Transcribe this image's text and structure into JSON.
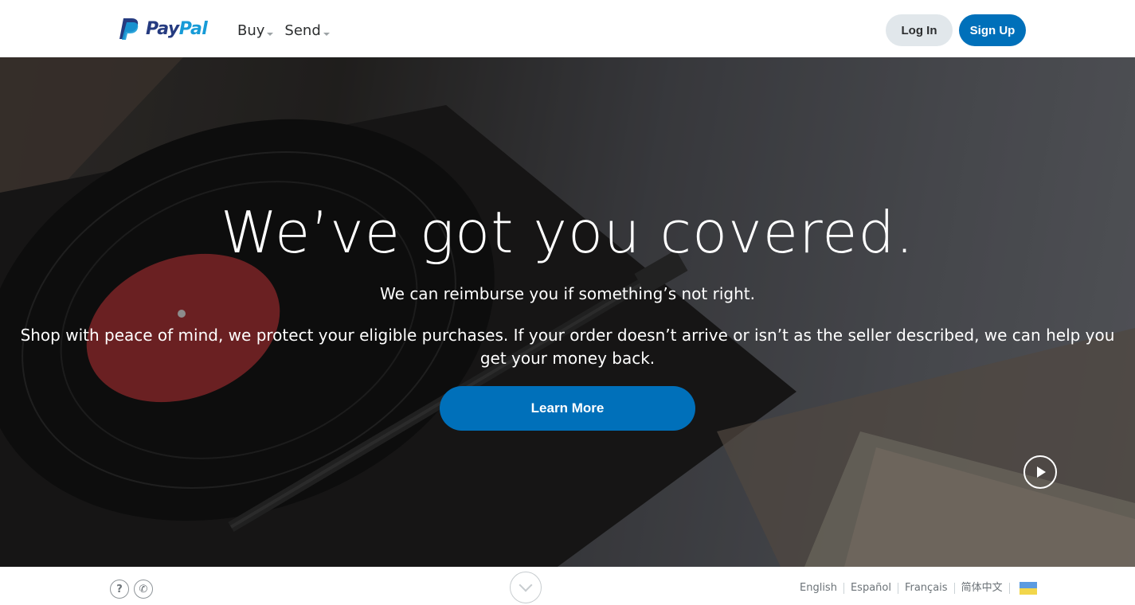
{
  "brand": {
    "name_part1": "Pay",
    "name_part2": "Pal",
    "primary_color": "#253b80",
    "secondary_color": "#179bd7",
    "accent_color": "#0070ba"
  },
  "nav": {
    "items": [
      {
        "label": "Buy",
        "icon": "caret-down-icon"
      },
      {
        "label": "Send",
        "icon": "caret-down-icon"
      }
    ]
  },
  "header": {
    "login_label": "Log In",
    "signup_label": "Sign Up"
  },
  "hero": {
    "title": "We’ve got you covered.",
    "subtitle": "We can reimburse you if something’s not right.",
    "description": "Shop with peace of mind, we protect your eligible purchases. If your order doesn’t arrive or isn’t as the seller described, we can help you get your money back.",
    "cta_label": "Learn More",
    "video_icon": "play-icon"
  },
  "footer": {
    "help_icon": "help-icon",
    "help_glyph": "?",
    "phone_icon": "phone-icon",
    "phone_glyph": "✆",
    "scroll_icon": "chevron-down-icon",
    "languages": [
      "English",
      "Español",
      "Français",
      "简体中文"
    ],
    "flag_icon": "country-flag-icon"
  }
}
